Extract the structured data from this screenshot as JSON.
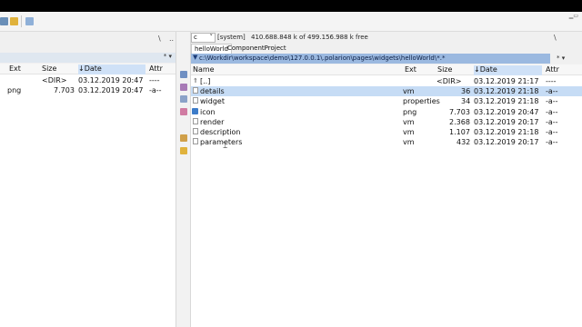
{
  "left_panel": {
    "backslash": "\\",
    "dots": "..",
    "path_buttons": "* ▾",
    "columns": {
      "ext": "Ext",
      "size": "Size",
      "date": "↓Date",
      "attr": "Attr"
    },
    "rows": [
      {
        "name": "",
        "ext": "",
        "size": "<DIR>",
        "date": "03.12.2019 20:47",
        "attr": "----"
      },
      {
        "name": "",
        "ext": "png",
        "size": "7.703",
        "date": "03.12.2019 20:47",
        "attr": "-a--"
      }
    ]
  },
  "right_panel": {
    "drive": {
      "letter": "c",
      "label": "[system]",
      "free": "410.688.848 k of 499.156.988 k free"
    },
    "backslash": "\\",
    "dots": "..",
    "tabs": [
      "helloWorld",
      "ComponentProject"
    ],
    "path": "c:\\Workdir\\workspace\\demo\\127.0.0.1\\.polarion\\pages\\widgets\\helloWorld\\*.*",
    "path_buttons": "* ▾",
    "columns": {
      "name": "Name",
      "ext": "Ext",
      "size": "Size",
      "date": "↓Date",
      "attr": "Attr"
    },
    "rows": [
      {
        "icon": "up-icon",
        "name": "[..]",
        "ext": "",
        "size": "<DIR>",
        "date": "03.12.2019 21:17",
        "attr": "----",
        "selected": false
      },
      {
        "icon": "file-icon",
        "name": "details",
        "ext": "vm",
        "size": "36",
        "date": "03.12.2019 21:18",
        "attr": "-a--",
        "selected": true
      },
      {
        "icon": "file-icon",
        "name": "widget",
        "ext": "properties",
        "size": "34",
        "date": "03.12.2019 21:18",
        "attr": "-a--",
        "selected": false
      },
      {
        "icon": "image-icon",
        "name": "icon",
        "ext": "png",
        "size": "7.703",
        "date": "03.12.2019 20:47",
        "attr": "-a--",
        "selected": false
      },
      {
        "icon": "file-icon",
        "name": "render",
        "ext": "vm",
        "size": "2.368",
        "date": "03.12.2019 20:17",
        "attr": "-a--",
        "selected": false
      },
      {
        "icon": "file-icon",
        "name": "description",
        "ext": "vm",
        "size": "1.107",
        "date": "03.12.2019 21:18",
        "attr": "-a--",
        "selected": false
      },
      {
        "icon": "file-icon",
        "name": "parameters",
        "ext": "vm",
        "size": "432",
        "date": "03.12.2019 20:17",
        "attr": "-a--",
        "selected": false
      }
    ]
  },
  "colors": {
    "selection": "#c6dcf5",
    "path_active": "#9bb9e0",
    "sorted_header": "#cfe1f7"
  }
}
